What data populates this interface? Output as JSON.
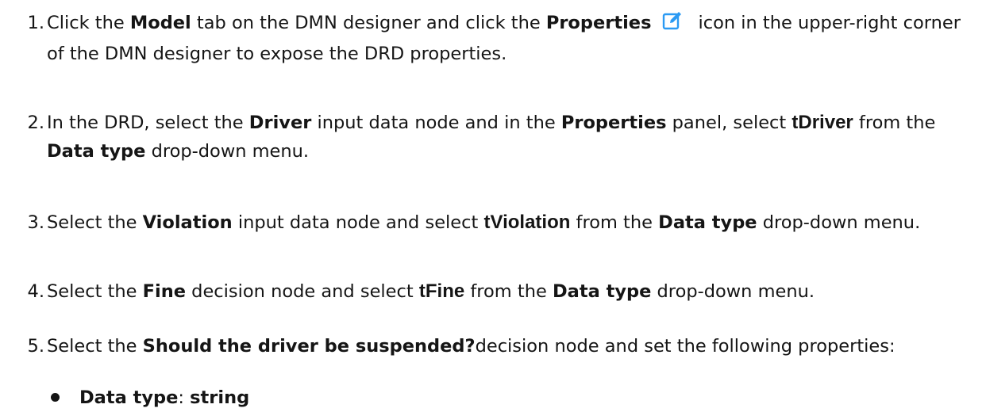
{
  "steps": [
    {
      "number": "1.",
      "parts": [
        {
          "t": "Click the "
        },
        {
          "t": "Model",
          "b": true
        },
        {
          "t": " tab on the DMN designer and click the "
        },
        {
          "t": "Properties",
          "b": true
        },
        {
          "icon": "edit-icon"
        },
        {
          "t": "icon in the upper-right corner of the DMN designer to expose the DRD properties."
        }
      ]
    },
    {
      "number": "2.",
      "parts": [
        {
          "t": "In the DRD, select the "
        },
        {
          "t": "Driver",
          "b": true
        },
        {
          "t": " input data node and in the "
        },
        {
          "t": "Properties",
          "b": true
        },
        {
          "t": " panel, select "
        },
        {
          "t": "tDriver",
          "b": true,
          "sans": true
        },
        {
          "t": " from the "
        },
        {
          "t": "Data type",
          "b": true
        },
        {
          "t": " drop-down menu."
        }
      ]
    },
    {
      "number": "3.",
      "parts": [
        {
          "t": "Select the "
        },
        {
          "t": "Violation",
          "b": true
        },
        {
          "t": " input data node and select "
        },
        {
          "t": "tViolation",
          "b": true,
          "sans": true
        },
        {
          "t": " from the "
        },
        {
          "t": "Data type",
          "b": true
        },
        {
          "t": " drop-down menu."
        }
      ]
    },
    {
      "number": "4.",
      "parts": [
        {
          "t": "Select the "
        },
        {
          "t": "Fine",
          "b": true
        },
        {
          "t": " decision node and select "
        },
        {
          "t": "tFine",
          "b": true,
          "sans": true
        },
        {
          "t": " from the "
        },
        {
          "t": "Data type",
          "b": true
        },
        {
          "t": " drop-down menu."
        }
      ]
    },
    {
      "number": "5.",
      "parts": [
        {
          "t": "Select the "
        },
        {
          "t": "Should the driver be suspended?",
          "b": true
        },
        {
          "t": "decision node and set the following properties:"
        }
      ]
    }
  ],
  "bullets": [
    {
      "label": "Data type",
      "sep": ": ",
      "value": "string"
    }
  ],
  "colors": {
    "icon": "#2b9af3",
    "text": "#151515"
  }
}
